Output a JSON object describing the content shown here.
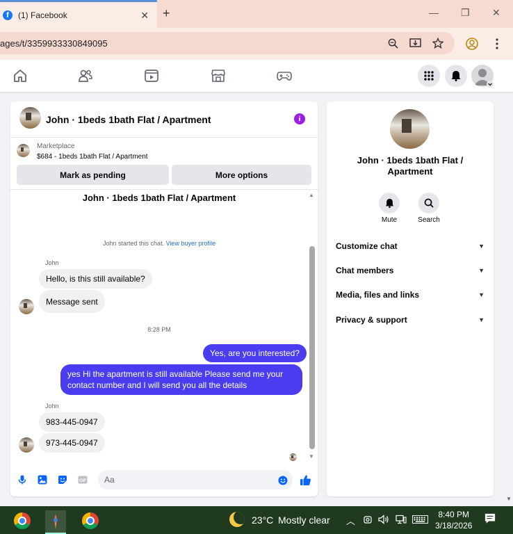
{
  "browser": {
    "tab_title": "(1) Facebook",
    "tab_close": "✕",
    "new_tab": "+",
    "url": "ages/t/3359933330849095",
    "win_minimize": "—",
    "win_restore": "❐",
    "win_close": "✕"
  },
  "chat": {
    "title": "John · 1beds 1bath Flat / Apartment",
    "info_glyph": "i",
    "marketplace_label": "Marketplace",
    "listing_summary": "$684 - 1beds 1bath Flat / Apartment",
    "mark_pending_label": "Mark as pending",
    "more_options_label": "More options",
    "topic": "John · 1beds 1bath Flat / Apartment",
    "started_text": "John started this chat.",
    "buyer_profile_link": "View buyer profile",
    "messages": [
      {
        "sender": "John",
        "text": "Hello, is this still available?"
      },
      {
        "text": "Message sent"
      },
      {
        "timestamp": "8:28 PM"
      },
      {
        "text": "Yes, are you interested?"
      },
      {
        "line1": "yes Hi the apartment is still available Please send me your",
        "line2": "contact number and I will send you all the details"
      },
      {
        "sender": "John",
        "text": "983-445-0947"
      },
      {
        "text": "973-445-0947"
      }
    ],
    "composer_placeholder": "Aa"
  },
  "info_panel": {
    "name": "John · 1beds 1bath Flat / Apartment",
    "actions": [
      {
        "label": "Mute",
        "icon": "bell-icon"
      },
      {
        "label": "Search",
        "icon": "search-icon"
      }
    ],
    "sections": [
      {
        "label": "Customize chat"
      },
      {
        "label": "Chat members"
      },
      {
        "label": "Media, files and links"
      },
      {
        "label": "Privacy & support"
      }
    ]
  },
  "taskbar": {
    "temperature": "23°C",
    "weather": "Mostly clear",
    "time": "8:40 PM",
    "date": "3/18/2026"
  },
  "colors": {
    "outgoing_bubble": "#4a3df0",
    "link": "#216fdb",
    "info_icon": "#9a1fe3",
    "fb_blue": "#1877f2"
  }
}
